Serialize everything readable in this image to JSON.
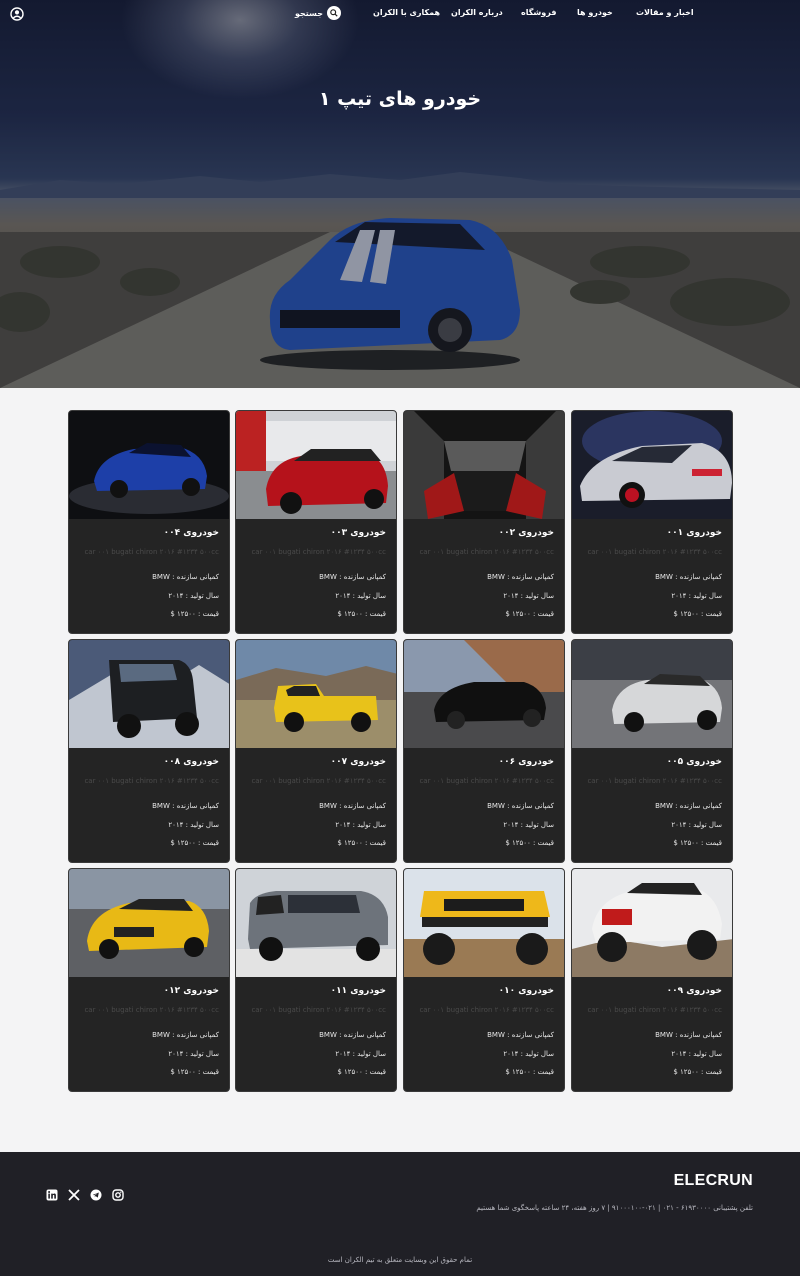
{
  "nav": {
    "links": [
      "اخبار و مقالات",
      "خودرو ها",
      "فروشگاه",
      "درباره الکران",
      "همکاری با الکران"
    ],
    "search_label": "جستجو",
    "search_icon": "search-icon",
    "user_icon": "user-icon"
  },
  "hero": {
    "title": "خودرو های تیپ ۱"
  },
  "cards": [
    {
      "title": "خودروی ۰۰۱",
      "desc": "car ۰۰۱ bugati chiron ۲۰۱۶ #۱۲۳۴ ۵۰۰cc",
      "maker": "کمپانی سازنده : BMW",
      "year": "سال تولید : ۲۰۱۴",
      "price": "قیمت : ۱۲۵۰۰ $"
    },
    {
      "title": "خودروی ۰۰۲",
      "desc": "car ۰۰۱ bugati chiron ۲۰۱۶ #۱۲۳۴ ۵۰۰cc",
      "maker": "کمپانی سازنده : BMW",
      "year": "سال تولید : ۲۰۱۴",
      "price": "قیمت : ۱۲۵۰۰ $"
    },
    {
      "title": "خودروی ۰۰۳",
      "desc": "car ۰۰۱ bugati chiron ۲۰۱۶ #۱۲۳۴ ۵۰۰cc",
      "maker": "کمپانی سازنده : BMW",
      "year": "سال تولید : ۲۰۱۴",
      "price": "قیمت : ۱۲۵۰۰ $"
    },
    {
      "title": "خودروی ۰۰۴",
      "desc": "car ۰۰۱ bugati chiron ۲۰۱۶ #۱۲۳۴ ۵۰۰cc",
      "maker": "کمپانی سازنده : BMW",
      "year": "سال تولید : ۲۰۱۴",
      "price": "قیمت : ۱۲۵۰۰ $"
    },
    {
      "title": "خودروی ۰۰۵",
      "desc": "car ۰۰۱ bugati chiron ۲۰۱۶ #۱۲۳۴ ۵۰۰cc",
      "maker": "کمپانی سازنده : BMW",
      "year": "سال تولید : ۲۰۱۴",
      "price": "قیمت : ۱۲۵۰۰ $"
    },
    {
      "title": "خودروی ۰۰۶",
      "desc": "car ۰۰۱ bugati chiron ۲۰۱۶ #۱۲۳۴ ۵۰۰cc",
      "maker": "کمپانی سازنده : BMW",
      "year": "سال تولید : ۲۰۱۴",
      "price": "قیمت : ۱۲۵۰۰ $"
    },
    {
      "title": "خودروی ۰۰۷",
      "desc": "car ۰۰۱ bugati chiron ۲۰۱۶ #۱۲۳۴ ۵۰۰cc",
      "maker": "کمپانی سازنده : BMW",
      "year": "سال تولید : ۲۰۱۴",
      "price": "قیمت : ۱۲۵۰۰ $"
    },
    {
      "title": "خودروی ۰۰۸",
      "desc": "car ۰۰۱ bugati chiron ۲۰۱۶ #۱۲۳۴ ۵۰۰cc",
      "maker": "کمپانی سازنده : BMW",
      "year": "سال تولید : ۲۰۱۴",
      "price": "قیمت : ۱۲۵۰۰ $"
    },
    {
      "title": "خودروی ۰۰۹",
      "desc": "car ۰۰۱ bugati chiron ۲۰۱۶ #۱۲۳۴ ۵۰۰cc",
      "maker": "کمپانی سازنده : BMW",
      "year": "سال تولید : ۲۰۱۴",
      "price": "قیمت : ۱۲۵۰۰ $"
    },
    {
      "title": "خودروی ۰۱۰",
      "desc": "car ۰۰۱ bugati chiron ۲۰۱۶ #۱۲۳۴ ۵۰۰cc",
      "maker": "کمپانی سازنده : BMW",
      "year": "سال تولید : ۲۰۱۴",
      "price": "قیمت : ۱۲۵۰۰ $"
    },
    {
      "title": "خودروی ۰۱۱",
      "desc": "car ۰۰۱ bugati chiron ۲۰۱۶ #۱۲۳۴ ۵۰۰cc",
      "maker": "کمپانی سازنده : BMW",
      "year": "سال تولید : ۲۰۱۴",
      "price": "قیمت : ۱۲۵۰۰ $"
    },
    {
      "title": "خودروی ۰۱۲",
      "desc": "car ۰۰۱ bugati chiron ۲۰۱۶ #۱۲۳۴ ۵۰۰cc",
      "maker": "کمپانی سازنده : BMW",
      "year": "سال تولید : ۲۰۱۴",
      "price": "قیمت : ۱۲۵۰۰ $"
    }
  ],
  "footer": {
    "brand": "ELECRUN",
    "contact": "تلفن پشتیبانی ۶۱۹۳۰۰۰۰ - ۰۲۱  |  ۰۲۱-۹۱۰۰۰۱۰۰  |  ۷ روز هفته، ۲۴ ساعته پاسخگوی شما هستیم",
    "copyright": "تمام حقوق این وبسایت متعلق به تیم الکران است",
    "socials": [
      "linkedin-icon",
      "x-icon",
      "telegram-icon",
      "instagram-icon"
    ]
  }
}
